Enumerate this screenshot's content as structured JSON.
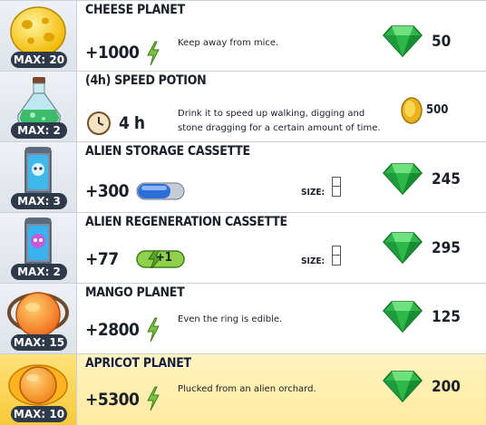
{
  "items": [
    {
      "title": "CHEESE PLANET",
      "max": "MAX: 20",
      "amount": "+1000",
      "desc": "Keep away from mice.",
      "price": "50",
      "currency": "gem-icon"
    },
    {
      "title": "(4h) SPEED POTION",
      "max": "MAX: 2",
      "duration": "4 h",
      "desc": "Drink it to speed up walking, digging and stone dragging for a certain amount of time.",
      "price": "500",
      "currency": "coin-icon"
    },
    {
      "title": "ALIEN STORAGE CASSETTE",
      "max": "MAX: 3",
      "amount": "+300",
      "size_label": "SIZE:",
      "price": "245",
      "currency": "gem-icon"
    },
    {
      "title": "ALIEN REGENERATION CASSETTE",
      "max": "MAX: 2",
      "amount": "+77",
      "regen_badge": "+1",
      "size_label": "SIZE:",
      "price": "295",
      "currency": "gem-icon"
    },
    {
      "title": "MANGO PLANET",
      "max": "MAX: 15",
      "amount": "+2800",
      "desc": "Even the ring is edible.",
      "price": "125",
      "currency": "gem-icon"
    },
    {
      "title": "APRICOT PLANET",
      "max": "MAX: 10",
      "amount": "+5300",
      "desc": "Plucked from an alien orchard.",
      "price": "200",
      "currency": "gem-icon"
    }
  ]
}
